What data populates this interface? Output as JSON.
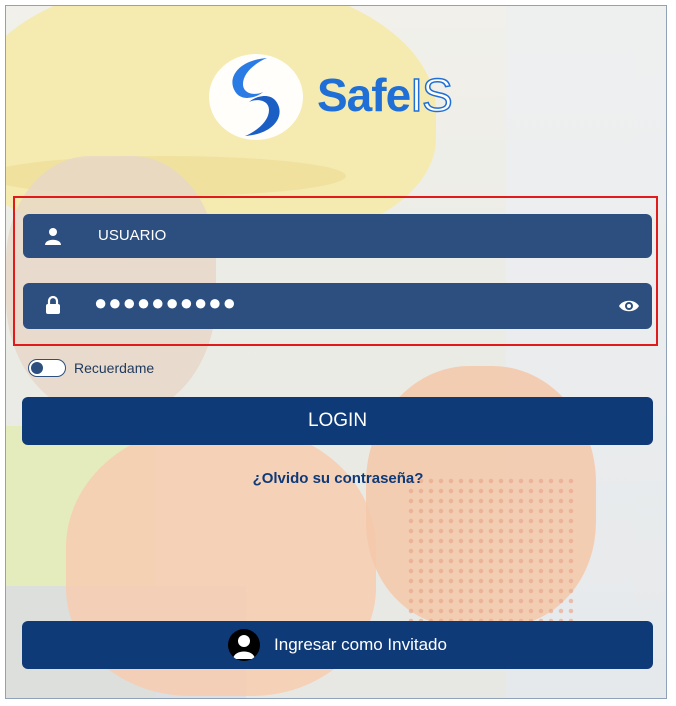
{
  "logo": {
    "brand_part1": "Safe",
    "brand_part2": "IS"
  },
  "login_form": {
    "username_value": "USUARIO",
    "password_masked": "●●●●●●●●●●",
    "remember_label": "Recuerdame",
    "remember_checked": false,
    "login_label": "LOGIN",
    "forgot_label": "¿Olvido su contraseña?",
    "guest_label": "Ingresar como Invitado"
  },
  "icons": {
    "username": "user-icon",
    "password": "lock-icon",
    "reveal": "eye-icon",
    "guest": "avatar-icon",
    "logo": "s-swirl-logo"
  },
  "colors": {
    "field_bg": "#2d4f7f",
    "button_bg": "#0f3a78",
    "brand_blue": "#1f6fd6",
    "highlight": "#e11b1b"
  }
}
